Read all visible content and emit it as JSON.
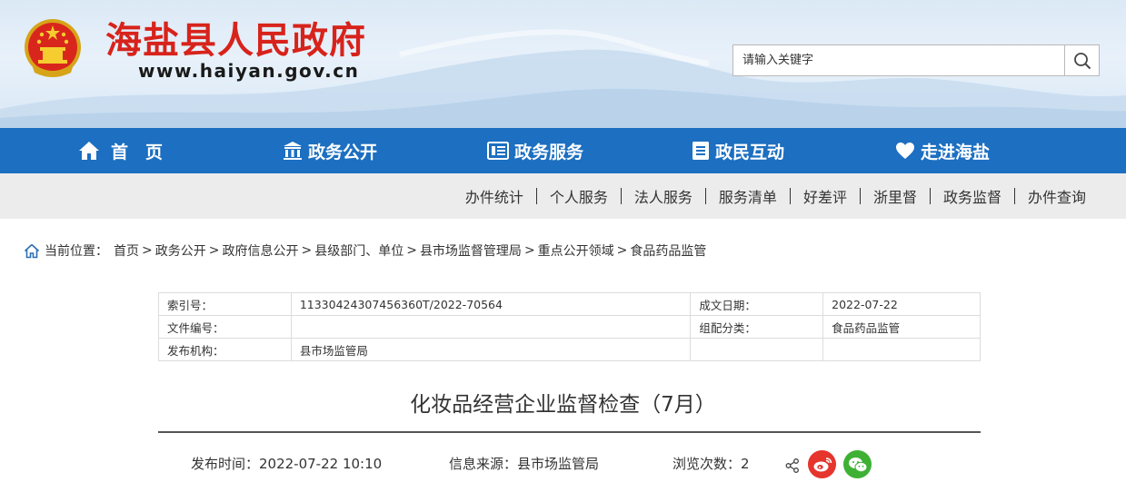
{
  "header": {
    "site_title": "海盐县人民政府",
    "site_url": "www.haiyan.gov.cn",
    "search_placeholder": "请输入关键字"
  },
  "main_nav": [
    {
      "label": "首　页",
      "icon": "home-icon"
    },
    {
      "label": "政务公开",
      "icon": "building-icon"
    },
    {
      "label": "政务服务",
      "icon": "list-card-icon"
    },
    {
      "label": "政民互动",
      "icon": "document-icon"
    },
    {
      "label": "走进海盐",
      "icon": "heart-icon"
    }
  ],
  "sub_nav": [
    "办件统计",
    "个人服务",
    "法人服务",
    "服务清单",
    "好差评",
    "浙里督",
    "政务监督",
    "办件查询"
  ],
  "breadcrumb": {
    "prefix": "当前位置：",
    "items": [
      "首页",
      "政务公开",
      "政府信息公开",
      "县级部门、单位",
      "县市场监督管理局",
      "重点公开领域",
      "食品药品监管"
    ]
  },
  "info_table": {
    "rows": [
      [
        "索引号：",
        "11330424307456360T/2022-70564",
        "成文日期：",
        "2022-07-22"
      ],
      [
        "文件编号：",
        "",
        "组配分类：",
        "食品药品监管"
      ],
      [
        "发布机构：",
        "县市场监管局",
        "",
        ""
      ]
    ]
  },
  "article": {
    "title": "化妆品经营企业监督检查（7月）",
    "publish_time": "发布时间：2022-07-22 10:10",
    "source": "信息来源：县市场监管局",
    "views": "浏览次数：2"
  },
  "colors": {
    "title_red": "#d7231b",
    "nav_blue": "#1c6fc1",
    "subnav_gray": "#ececec",
    "weibo_red": "#e6352c",
    "wechat_green": "#3eb135"
  }
}
